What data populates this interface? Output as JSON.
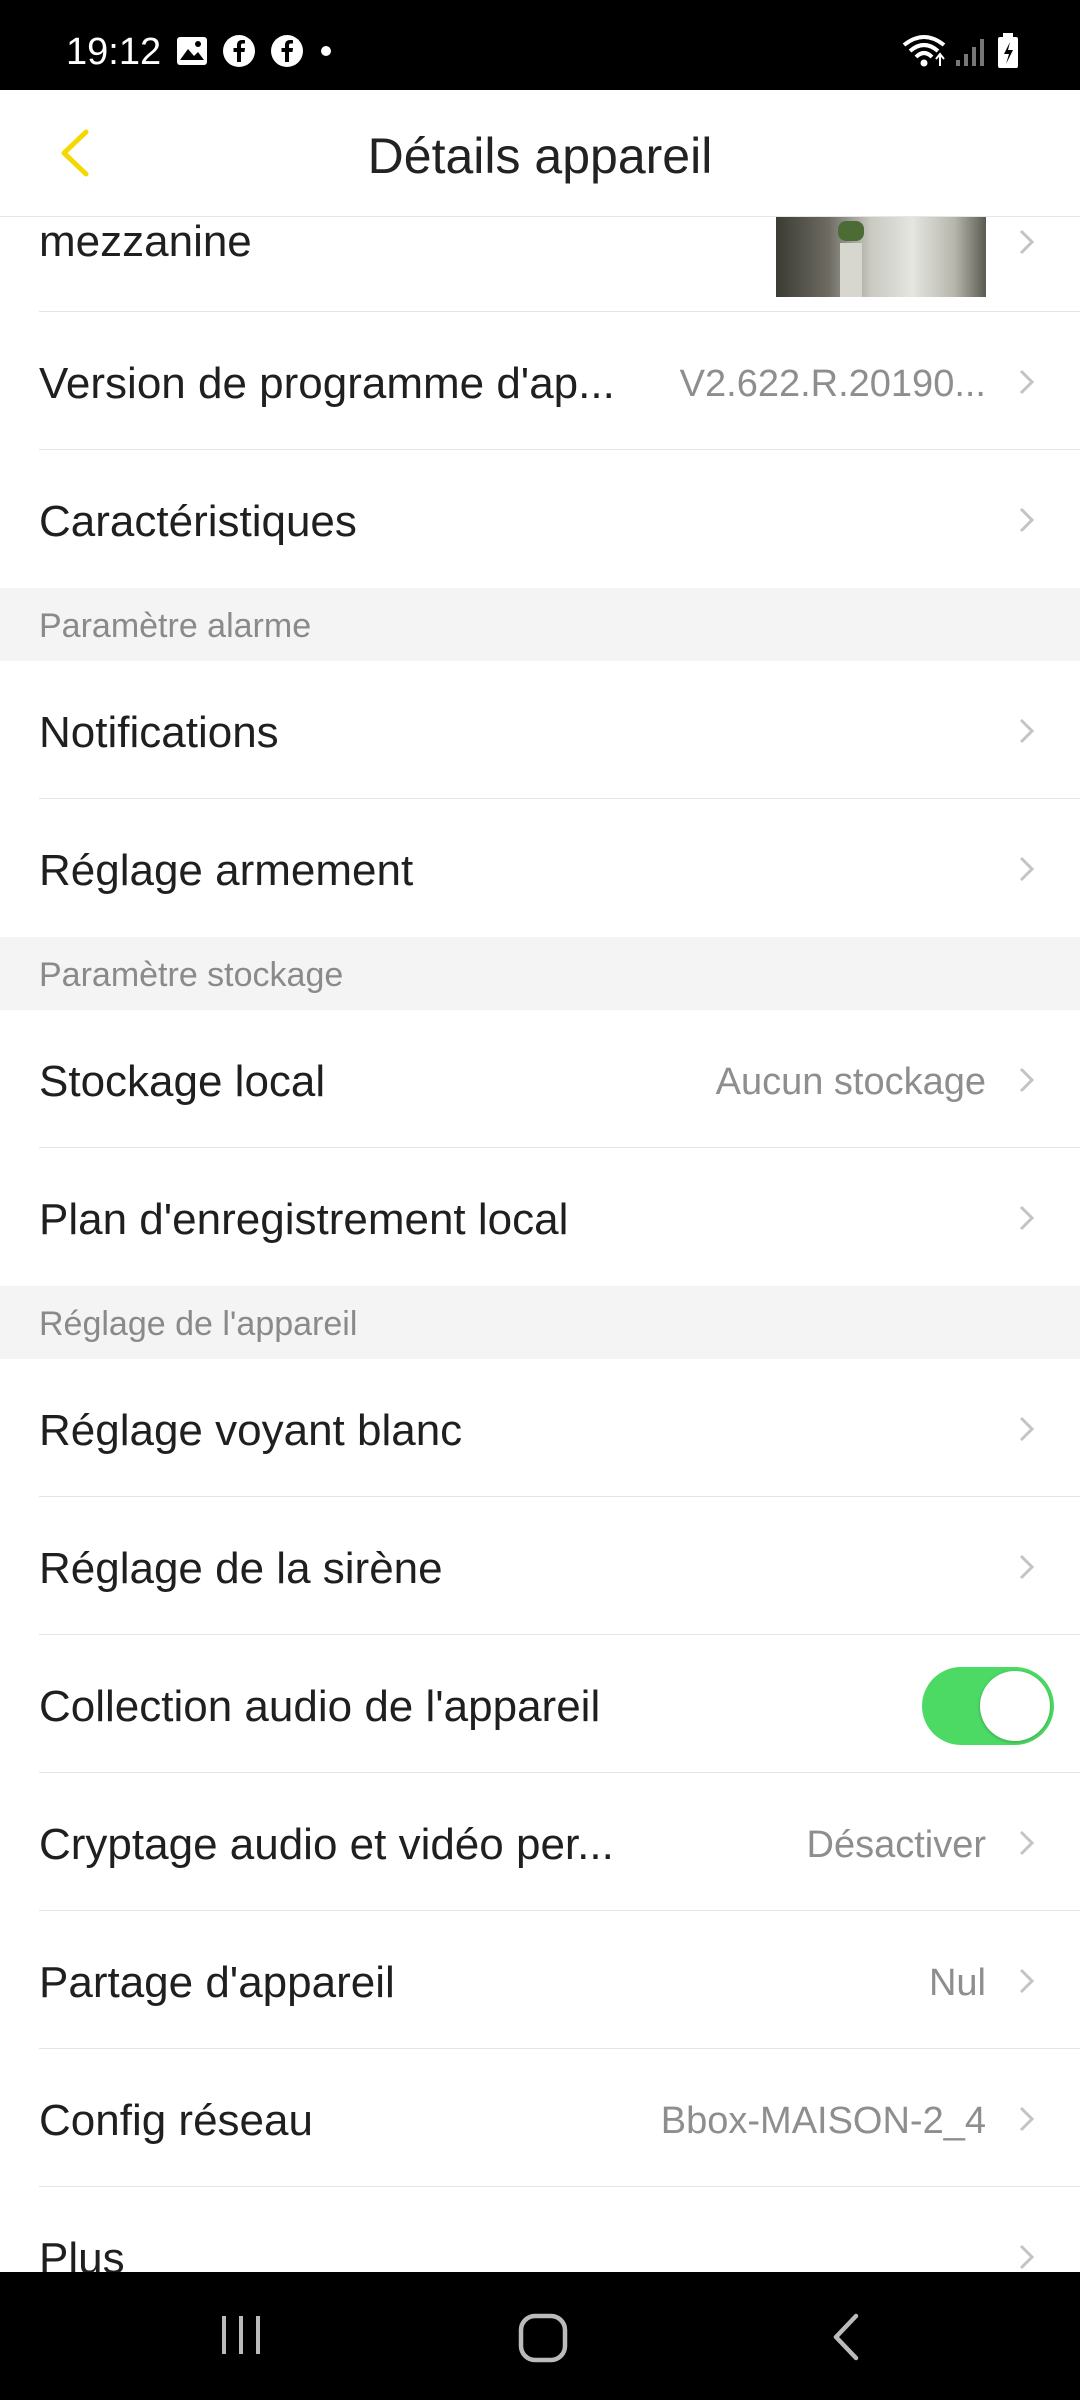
{
  "status_bar": {
    "time": "19:12",
    "left_icons": [
      "image-icon",
      "facebook-icon",
      "facebook-icon",
      "dot-icon"
    ],
    "right_icons": [
      "wifi-icon",
      "signal-icon",
      "battery-icon"
    ]
  },
  "header": {
    "title": "Détails appareil",
    "back_icon": "chevron-left-icon",
    "accent_color": "#f5d800"
  },
  "rows_top": [
    {
      "label": "mezzanine",
      "thumbnail": true
    },
    {
      "label": "Version de programme d'ap...",
      "value": "V2.622.R.20190..."
    },
    {
      "label": "Caractéristiques",
      "value": ""
    }
  ],
  "sections": {
    "alarm": {
      "title": "Paramètre alarme",
      "rows": [
        {
          "label": "Notifications",
          "value": ""
        },
        {
          "label": "Réglage armement",
          "value": ""
        }
      ]
    },
    "storage": {
      "title": "Paramètre stockage",
      "rows": [
        {
          "label": "Stockage local",
          "value": "Aucun stockage"
        },
        {
          "label": "Plan d'enregistrement local",
          "value": ""
        }
      ]
    },
    "device": {
      "title": "Réglage de l'appareil",
      "rows": [
        {
          "label": "Réglage voyant blanc",
          "value": ""
        },
        {
          "label": "Réglage de la sirène",
          "value": ""
        },
        {
          "label": "Collection audio de l'appareil",
          "toggle": true,
          "toggle_color": "#4cd964"
        },
        {
          "label": "Cryptage audio et vidéo per...",
          "value": "Désactiver"
        },
        {
          "label": "Partage d'appareil",
          "value": "Nul"
        },
        {
          "label": "Config réseau",
          "value": "Bbox-MAISON-2_4"
        },
        {
          "label": "Plus",
          "value": ""
        }
      ]
    }
  },
  "nav_bar": {
    "buttons": [
      "recent-apps-icon",
      "home-icon",
      "back-icon"
    ]
  }
}
